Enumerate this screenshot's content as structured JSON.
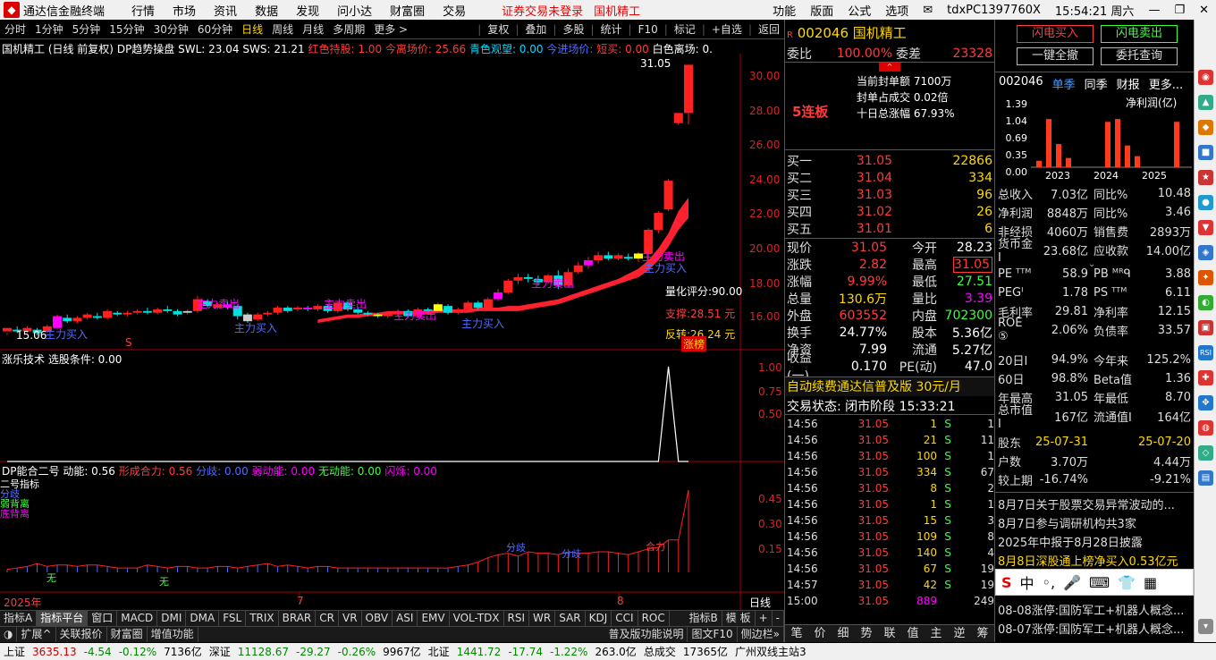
{
  "app": {
    "title": "通达信金融终端",
    "menus": [
      "行情",
      "市场",
      "资讯",
      "数据",
      "发现",
      "问小达",
      "财富圈",
      "交易"
    ],
    "warning": "证券交易未登录",
    "stock_short": "国机精工",
    "right_menus": [
      "功能",
      "版面",
      "公式",
      "选项"
    ],
    "user": "tdxPC1397760X",
    "time": "15:54:21 周六"
  },
  "periods": [
    "分时",
    "1分钟",
    "5分钟",
    "15分钟",
    "30分钟",
    "60分钟",
    "日线",
    "周线",
    "月线",
    "多周期",
    "更多 >"
  ],
  "active_period": "日线",
  "tools": [
    "复权",
    "叠加",
    "多股",
    "统计",
    "F10",
    "标记",
    "+自选",
    "返回"
  ],
  "chart_header": {
    "name": "国机精工 (日线 前复权)",
    "ind": "DP趋势操盘",
    "swl": "SWL: 23.04",
    "sws": "SWS: 21.21",
    "h1": "红色持股: 1.00",
    "h2": "今离场价: 25.66",
    "h3": "青色观望: 0.00",
    "h4": "今进场价:",
    "h5": "短买: 0.00",
    "h6": "白色离场: 0."
  },
  "price_axis": [
    "30.00",
    "28.00",
    "26.00",
    "24.00",
    "22.00",
    "20.00",
    "18.00",
    "16.00"
  ],
  "chart_labels": {
    "high": "31.05",
    "low": "15.06",
    "score": "量化评分:90.00",
    "support": "支撑:28.51 元",
    "reverse": "反转:26.24 元",
    "bang": "涨榜",
    "mark": "S",
    "buy": "主力买入",
    "sell": "主力卖出"
  },
  "mid_panel": {
    "header": "涨乐技术  选股条件: 0.00",
    "axis": [
      "1.00",
      "0.75",
      "0.50"
    ]
  },
  "low_panel": {
    "name": "DP能合二号",
    "d1": "动能: 0.56",
    "d2": "形成合力: 0.56",
    "d3": "分歧: 0.00",
    "d4": "弱动能: 0.00",
    "d5": "无动能: 0.00",
    "d6": "闪烁: 0.00",
    "axis": [
      "0.45",
      "0.30",
      "0.15"
    ],
    "left_labels": [
      "二号指标",
      "分歧",
      "弱背离",
      "底背离"
    ],
    "he": "合力",
    "fen": "分歧",
    "wu": "无"
  },
  "x_axis": {
    "year": "2025年",
    "m7": "7",
    "m8": "8",
    "period": "日线"
  },
  "tabs": [
    "指标A",
    "指标平台",
    "窗口",
    "MACD",
    "DMI",
    "DMA",
    "FSL",
    "TRIX",
    "BRAR",
    "CR",
    "VR",
    "OBV",
    "ASI",
    "EMV",
    "VOL-TDX",
    "RSI",
    "WR",
    "SAR",
    "KDJ",
    "CCI",
    "ROC",
    "指标B",
    "模 板",
    "+",
    "-"
  ],
  "tabs2": [
    "扩展^",
    "关联报价",
    "财富圈",
    "增值功能",
    "普及版功能说明",
    "图文F10",
    "侧边栏»"
  ],
  "status": {
    "sh_label": "上证",
    "sh": "3635.13",
    "sh_c": "-4.54",
    "sh_p": "-0.12%",
    "sh_v": "7136亿",
    "sz_label": "深证",
    "sz": "11128.67",
    "sz_c": "-29.27",
    "sz_p": "-0.26%",
    "sz_v": "9967亿",
    "bz_label": "北证",
    "bz": "1441.72",
    "bz_c": "-17.74",
    "bz_p": "-1.22%",
    "bz_v": "263.0亿",
    "total": "总成交",
    "total_v": "17365亿",
    "site": "广州双线主站3"
  },
  "quote": {
    "code": "002046",
    "name": "国机精工",
    "wb_label": "委比",
    "wb": "100.00%",
    "wc_label": "委差",
    "wc": "23328",
    "streak": "5连板",
    "seal1": "当前封单额  7100万",
    "seal2": "封单占成交  0.02倍",
    "seal3": "十日总涨幅  67.93%",
    "bids": [
      [
        "买一",
        "31.05",
        "22866"
      ],
      [
        "买二",
        "31.04",
        "334"
      ],
      [
        "买三",
        "31.03",
        "96"
      ],
      [
        "买四",
        "31.02",
        "26"
      ],
      [
        "买五",
        "31.01",
        "6"
      ]
    ],
    "stats": [
      [
        "现价",
        "31.05",
        "今开",
        "28.23"
      ],
      [
        "涨跌",
        "2.82",
        "最高",
        "31.05"
      ],
      [
        "涨幅",
        "9.99%",
        "最低",
        "27.51"
      ],
      [
        "总量",
        "130.6万",
        "量比",
        "3.39"
      ],
      [
        "外盘",
        "603552",
        "内盘",
        "702300"
      ],
      [
        "换手",
        "24.77%",
        "股本",
        "5.36亿"
      ],
      [
        "净资",
        "7.99",
        "流通",
        "5.27亿"
      ],
      [
        "收益(一)",
        "0.170",
        "PE(动)",
        "47.0"
      ]
    ],
    "ad": "自动续费通达信普及版  30元/月",
    "state": "交易状态: 闭市阶段 15:33:21",
    "ticks": [
      [
        "14:56",
        "31.05",
        "1",
        "S",
        "1"
      ],
      [
        "14:56",
        "31.05",
        "21",
        "S",
        "11"
      ],
      [
        "14:56",
        "31.05",
        "100",
        "S",
        "1"
      ],
      [
        "14:56",
        "31.05",
        "334",
        "S",
        "67"
      ],
      [
        "14:56",
        "31.05",
        "8",
        "S",
        "2"
      ],
      [
        "14:56",
        "31.05",
        "1",
        "S",
        "1"
      ],
      [
        "14:56",
        "31.05",
        "15",
        "S",
        "3"
      ],
      [
        "14:56",
        "31.05",
        "109",
        "S",
        "8"
      ],
      [
        "14:56",
        "31.05",
        "140",
        "S",
        "4"
      ],
      [
        "14:56",
        "31.05",
        "67",
        "S",
        "19"
      ],
      [
        "14:57",
        "31.05",
        "42",
        "S",
        "19"
      ],
      [
        "15:00",
        "31.05",
        "889",
        "",
        "249"
      ]
    ],
    "footer": [
      "笔",
      "价",
      "细",
      "势",
      "联",
      "值",
      "主",
      "逆",
      "筹"
    ]
  },
  "fin": {
    "btn1": "闪电买入",
    "btn2": "闪电卖出",
    "btn3": "一键全撤",
    "btn4": "委托查询",
    "code": "002046",
    "t1": "单季",
    "t2": "同季",
    "t3": "财报",
    "t4": "更多...",
    "axis": [
      "1.39",
      "1.04",
      "0.69",
      "0.35",
      "0.00"
    ],
    "unit": "净利润(亿)",
    "years": [
      "2023",
      "2024",
      "2025"
    ],
    "bar_values": [
      0.14,
      1.04,
      0.5,
      0.2,
      0,
      0,
      0,
      0.98,
      1.04,
      0.47,
      0.24,
      0,
      0,
      0,
      0.98
    ],
    "rows": [
      [
        "总收入",
        "7.03亿",
        "同比%",
        "10.48"
      ],
      [
        "净利润",
        "8848万",
        "同比%",
        "3.46"
      ],
      [
        "非经损",
        "4060万",
        "销售费",
        "2893万"
      ],
      [
        "货币金I",
        "23.68亿",
        "应收款",
        "14.00亿"
      ],
      [
        "PE ᵀᵀᴹ",
        "58.9",
        "PB ᴹᴿᑫ",
        "3.88"
      ],
      [
        "PEGᴵ",
        "1.78",
        "PS ᵀᵀᴹ",
        "6.11"
      ],
      [
        "毛利率",
        "29.81",
        "净利率",
        "12.15"
      ],
      [
        "ROE ⑤",
        "2.06%",
        "负债率",
        "33.57"
      ],
      [
        "20日I",
        "94.9%",
        "今年来",
        "125.2%"
      ],
      [
        "60日",
        "98.8%",
        "Beta值",
        "1.36"
      ],
      [
        "年最高",
        "31.05",
        "年最低",
        "8.70"
      ],
      [
        "总市值I",
        "167亿",
        "流通值I",
        "164亿"
      ],
      [
        "股东",
        "25-07-31",
        "",
        "25-07-20"
      ],
      [
        "户数",
        "3.70万",
        "",
        "4.44万"
      ],
      [
        "较上期",
        "-16.74%",
        "",
        "-9.21%"
      ]
    ],
    "news": [
      "8月7日关于股票交易异常波动的...",
      "8月7日参与调研机构共3家",
      "2025年中报于8月28日披露",
      "8月8日深股通上榜净买入0.53亿元",
      "08-08涨停:国防军工+机器人概念...",
      "08-07涨停:国防军工+机器人概念..."
    ],
    "ime": [
      "中",
      "◦,"
    ]
  },
  "chart_data": {
    "type": "candlestick",
    "title": "国机精工 (日线 前复权)",
    "ylim": [
      14.8,
      31.6
    ],
    "candles": [
      [
        15.3,
        15.5,
        15.2,
        15.1
      ],
      [
        15.4,
        15.3,
        15.6,
        15.2
      ],
      [
        15.3,
        15.5,
        15.6,
        15.2
      ],
      [
        15.4,
        15.2,
        15.5,
        15.06
      ],
      [
        15.3,
        15.6,
        15.7,
        15.2
      ],
      [
        15.5,
        16.2,
        16.3,
        15.4
      ],
      [
        16.1,
        15.9,
        16.3,
        15.8
      ],
      [
        15.9,
        16.1,
        16.2,
        15.8
      ],
      [
        16.1,
        16.3,
        16.4,
        16
      ],
      [
        16.2,
        16.1,
        16.4,
        16
      ],
      [
        16.1,
        16.5,
        16.6,
        16
      ],
      [
        16.4,
        16.3,
        16.5,
        16.2
      ],
      [
        16.3,
        16.4,
        16.5,
        16.2
      ],
      [
        16.4,
        16.5,
        16.6,
        16.3
      ],
      [
        16.5,
        16.4,
        16.7,
        16.3
      ],
      [
        16.4,
        16.6,
        16.7,
        16.3
      ],
      [
        16.6,
        16.5,
        16.8,
        16.4
      ],
      [
        16.5,
        16.3,
        16.6,
        16.2
      ],
      [
        16.4,
        16.5,
        16.6,
        16.3
      ],
      [
        16.5,
        17.2,
        17.4,
        16.4
      ],
      [
        17.1,
        16.8,
        17.2,
        16.7
      ],
      [
        16.7,
        16.9,
        17.0,
        16.6
      ],
      [
        16.9,
        16.7,
        17.1,
        16.6
      ],
      [
        16.8,
        16.2,
        16.9,
        16.0
      ],
      [
        16.3,
        15.9,
        16.4,
        15.8
      ],
      [
        16.0,
        16.3,
        16.4,
        15.9
      ],
      [
        16.3,
        16.4,
        16.5,
        16.2
      ],
      [
        16.4,
        16.7,
        16.8,
        16.3
      ],
      [
        16.7,
        16.5,
        16.8,
        16.4
      ],
      [
        16.6,
        16.7,
        16.8,
        16.5
      ],
      [
        16.7,
        16.6,
        16.8,
        16.5
      ],
      [
        16.6,
        16.8,
        16.9,
        16.5
      ],
      [
        16.8,
        16.5,
        16.9,
        16.4
      ],
      [
        16.5,
        17.0,
        17.1,
        16.4
      ],
      [
        17.0,
        16.6,
        17.1,
        16.5
      ],
      [
        16.6,
        16.4,
        16.7,
        16.3
      ],
      [
        16.4,
        16.3,
        16.5,
        16.2
      ],
      [
        16.3,
        16.2,
        16.4,
        16.1
      ],
      [
        16.2,
        16.3,
        16.4,
        16.1
      ],
      [
        16.3,
        16.5,
        16.6,
        16.2
      ],
      [
        16.5,
        16.2,
        16.6,
        16.1
      ],
      [
        16.2,
        16.6,
        16.7,
        16.1
      ],
      [
        16.6,
        16.5,
        16.7,
        16.4
      ],
      [
        16.5,
        16.9,
        17.0,
        16.4
      ],
      [
        16.8,
        16.4,
        16.9,
        16.3
      ],
      [
        16.4,
        16.6,
        16.7,
        16.3
      ],
      [
        16.6,
        17.0,
        17.1,
        16.5
      ],
      [
        17.0,
        16.7,
        17.1,
        16.6
      ],
      [
        16.7,
        17.2,
        17.3,
        16.6
      ],
      [
        17.2,
        17.6,
        17.8,
        17.1
      ],
      [
        17.6,
        18.3,
        18.4,
        17.5
      ],
      [
        18.3,
        18.5,
        18.7,
        18.1
      ],
      [
        18.5,
        18.4,
        18.7,
        18.2
      ],
      [
        18.4,
        18.2,
        18.6,
        18.0
      ],
      [
        18.2,
        18.6,
        18.7,
        18.1
      ],
      [
        18.6,
        18.0,
        18.9,
        17.8
      ],
      [
        18.0,
        18.8,
        19.0,
        17.9
      ],
      [
        18.8,
        19.2,
        19.4,
        18.7
      ],
      [
        19.2,
        19.5,
        19.7,
        19.0
      ],
      [
        19.5,
        19.8,
        20.0,
        19.3
      ],
      [
        19.8,
        19.6,
        20.0,
        19.5
      ],
      [
        19.6,
        19.8,
        19.9,
        19.5
      ],
      [
        19.7,
        19.6,
        19.9,
        19.5
      ],
      [
        19.6,
        19.9,
        20.0,
        19.4
      ],
      [
        19.9,
        21.3,
        21.4,
        19.4
      ],
      [
        21.3,
        22.3,
        22.4,
        21.1
      ],
      [
        22.5,
        24.2,
        24.3,
        22.4
      ],
      [
        27.6,
        28.2,
        28.2,
        27.5
      ],
      [
        28.2,
        31.05,
        31.05,
        27.51
      ]
    ],
    "up_line": [
      16.0,
      16.1,
      16.2,
      16.3,
      16.3,
      16.4,
      16.4,
      16.5,
      16.5,
      16.5,
      16.5,
      16.5,
      16.6,
      16.6,
      16.6,
      16.6,
      16.7,
      16.7,
      16.7,
      16.8,
      16.8,
      16.9,
      17.0,
      17.1,
      17.2,
      17.4,
      17.6,
      17.8,
      18.0,
      18.2,
      18.4,
      18.7,
      19.0,
      19.5,
      20.2,
      21.1,
      22.4,
      23.2
    ],
    "dn_line": [
      15.8,
      15.9,
      16.0,
      16.1,
      16.1,
      16.2,
      16.2,
      16.3,
      16.3,
      16.3,
      16.3,
      16.3,
      16.4,
      16.4,
      16.4,
      16.4,
      16.5,
      16.5,
      16.5,
      16.5,
      16.5,
      16.6,
      16.7,
      16.8,
      16.9,
      17.1,
      17.3,
      17.5,
      17.7,
      17.9,
      18.1,
      18.3,
      18.5,
      18.9,
      19.5,
      20.3,
      21.3,
      22.0
    ],
    "signal": [
      0,
      0,
      0,
      0,
      0,
      0,
      0,
      0,
      0,
      0,
      0,
      0,
      0,
      0,
      0,
      0,
      0,
      0,
      0,
      0,
      0,
      0,
      0,
      0,
      0,
      0,
      0,
      0,
      0,
      0,
      0,
      0,
      0,
      0,
      0,
      0,
      0,
      0,
      0,
      0,
      0,
      0,
      0,
      0,
      0,
      0,
      0,
      0,
      0,
      0,
      0,
      0,
      0,
      0,
      0,
      0,
      0,
      0,
      0,
      0,
      0,
      0,
      0,
      0,
      0,
      0,
      1,
      0,
      0
    ],
    "energy": [
      0.02,
      0.03,
      0.04,
      0.06,
      0.04,
      0.05,
      0.05,
      0.04,
      0.05,
      0.05,
      0.04,
      0.03,
      0.03,
      0.03,
      0.05,
      0.04,
      0.03,
      0.04,
      0.04,
      0.03,
      0.03,
      0.04,
      0.04,
      0.03,
      0.04,
      0.05,
      0.06,
      0.04,
      0.05,
      0.04,
      0.03,
      0.04,
      0.04,
      0.03,
      0.03,
      0.03,
      0.03,
      0.03,
      0.03,
      0.03,
      0.03,
      0.03,
      0.03,
      0.03,
      0.03,
      0.04,
      0.05,
      0.07,
      0.1,
      0.12,
      0.13,
      0.11,
      0.14,
      0.13,
      0.13,
      0.12,
      0.14,
      0.13,
      0.13,
      0.14,
      0.14,
      0.13,
      0.12,
      0.14,
      0.16,
      0.17,
      0.22,
      0.22,
      0.56
    ]
  }
}
